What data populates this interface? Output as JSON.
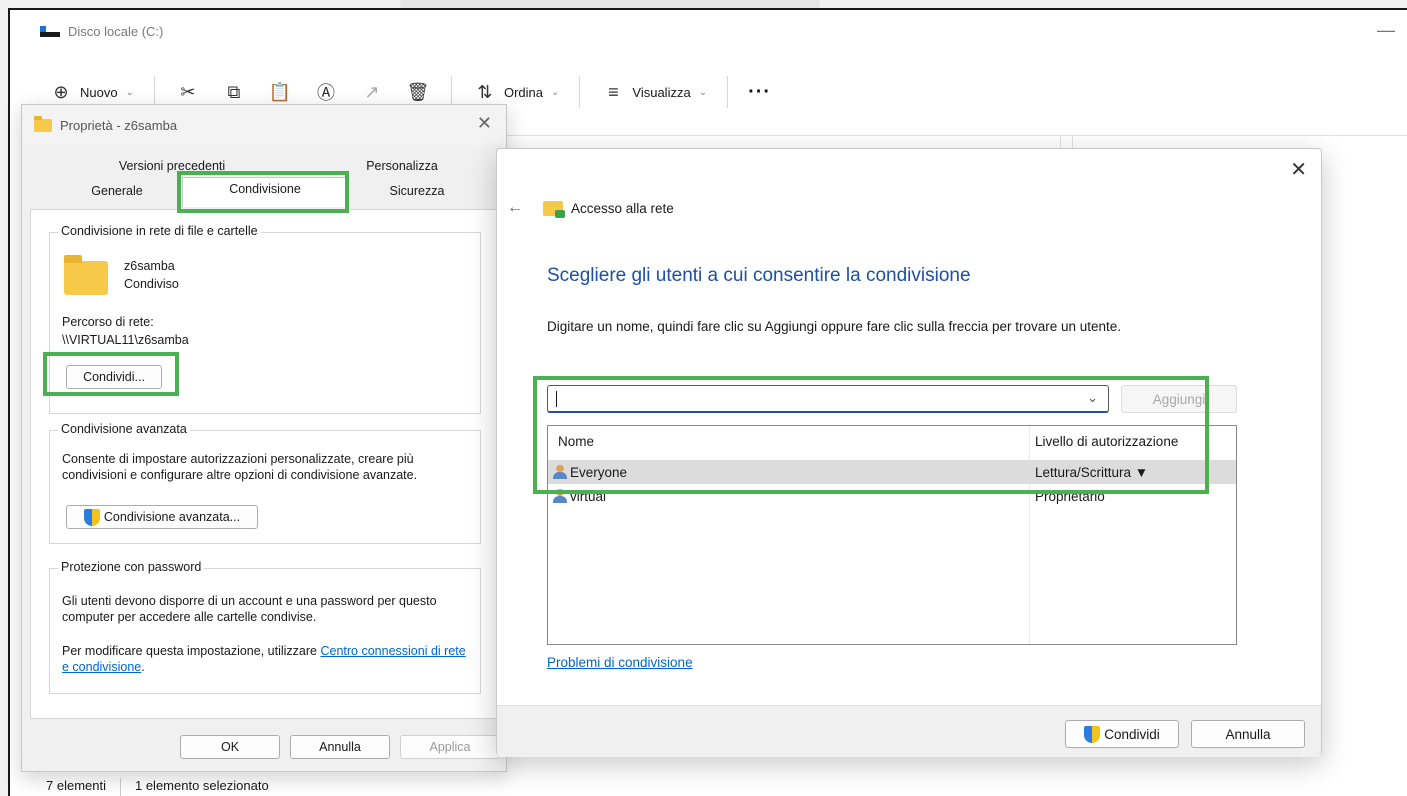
{
  "explorer": {
    "title": "Disco locale (C:)",
    "toolbar": {
      "new_label": "Nuovo",
      "sort_label": "Ordina",
      "view_label": "Visualizza",
      "more_label": "···"
    },
    "status": {
      "items": "7 elementi",
      "selected": "1 elemento selezionato"
    }
  },
  "properties": {
    "title": "Proprietà - z6samba",
    "tabs": {
      "previous_versions": "Versioni precedenti",
      "customize": "Personalizza",
      "general": "Generale",
      "sharing": "Condivisione",
      "security": "Sicurezza"
    },
    "network_sharing": {
      "legend": "Condivisione in rete di file e cartelle",
      "folder_name": "z6samba",
      "folder_state": "Condiviso",
      "path_label": "Percorso di rete:",
      "path_value": "\\\\VIRTUAL11\\z6samba",
      "share_button": "Condividi..."
    },
    "advanced_sharing": {
      "legend": "Condivisione avanzata",
      "description": "Consente di impostare autorizzazioni personalizzate, creare più condivisioni e configurare altre opzioni di condivisione avanzate.",
      "button": "Condivisione avanzata..."
    },
    "password_protection": {
      "legend": "Protezione con password",
      "description": "Gli utenti devono disporre di un account e una password per questo computer per accedere alle cartelle condivise.",
      "change_prefix": "Per modificare questa impostazione, utilizzare ",
      "change_link": "Centro connessioni di rete e condivisione",
      "change_suffix": "."
    },
    "footer": {
      "ok": "OK",
      "cancel": "Annulla",
      "apply": "Applica"
    }
  },
  "network_access": {
    "header": "Accesso alla rete",
    "heading": "Scegliere gli utenti a cui consentire la condivisione",
    "description": "Digitare un nome, quindi fare clic su Aggiungi oppure fare clic sulla freccia per trovare un utente.",
    "input_value": "",
    "add_button": "Aggiungi",
    "columns": {
      "name": "Nome",
      "permission": "Livello di autorizzazione"
    },
    "rows": [
      {
        "name": "Everyone",
        "permission": "Lettura/Scrittura ▼"
      },
      {
        "name": "virtual",
        "permission": "Proprietario"
      }
    ],
    "trouble_link": "Problemi di condivisione",
    "share_button": "Condividi",
    "cancel_button": "Annulla"
  },
  "colors": {
    "highlight": "#4caf50",
    "heading_blue": "#1f4fa3",
    "link_blue": "#0066cc"
  }
}
